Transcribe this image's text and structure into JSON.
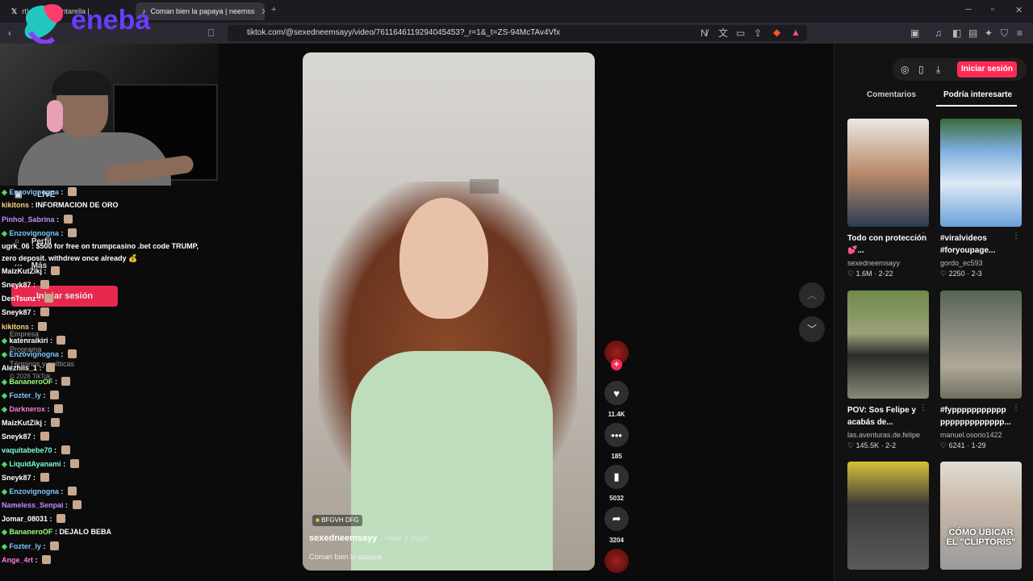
{
  "browser": {
    "tabs": [
      {
        "label": "rt) on X: \"Cantarella | ",
        "icon": "x-logo-icon"
      },
      {
        "label": "Coman bien la papaya | neemss",
        "icon": "tiktok-icon"
      }
    ],
    "url": "tiktok.com/@sexedneemsayy/video/7611646119294045453?_r=1&_t=ZS-94McTAv4Vfx"
  },
  "stream": {
    "brand": "eneba",
    "chat": [
      {
        "user": "Enzovignogna",
        "text": "",
        "color": "#7ec8ff",
        "badge": true,
        "emote": true
      },
      {
        "user": "kikitons",
        "text": "INFORMACION DE ORO",
        "color": "#ffd27a",
        "badge": false,
        "emote": false
      },
      {
        "user": "Pinhol_Sabrina",
        "text": "",
        "color": "#c08cff",
        "badge": false,
        "emote": true
      },
      {
        "user": "Enzovignogna",
        "text": "",
        "color": "#7ec8ff",
        "badge": true,
        "emote": true
      },
      {
        "user": "ugrk_06",
        "text": "$500 for free on trumpcasino .bet code TRUMP,",
        "color": "#ffffff",
        "badge": false,
        "emote": false
      },
      {
        "user": "",
        "text": "zero deposit. withdrew once already 💰",
        "color": "#ffffff",
        "badge": false,
        "emote": false
      },
      {
        "user": "MaizKutZikj",
        "text": "",
        "color": "#ffffff",
        "badge": false,
        "emote": true
      },
      {
        "user": "Sneyk87",
        "text": "",
        "color": "#ffffff",
        "badge": false,
        "emote": true
      },
      {
        "user": "DenTsunz",
        "text": "",
        "color": "#ffffff",
        "badge": false,
        "emote": true
      },
      {
        "user": "Sneyk87",
        "text": "",
        "color": "#ffffff",
        "badge": false,
        "emote": true
      },
      {
        "user": "kikitons",
        "text": "",
        "color": "#ffd27a",
        "badge": false,
        "emote": true
      },
      {
        "user": "katenraikiri",
        "text": "",
        "color": "#ffffff",
        "badge": true,
        "emote": true
      },
      {
        "user": "Enzovignogna",
        "text": "",
        "color": "#7ec8ff",
        "badge": true,
        "emote": true
      },
      {
        "user": "Alezhiis_1",
        "text": "",
        "color": "#ffffff",
        "badge": false,
        "emote": true
      },
      {
        "user": "BananeroOF",
        "text": "",
        "color": "#9cff7a",
        "badge": true,
        "emote": true
      },
      {
        "user": "Fozter_ly",
        "text": "",
        "color": "#7ec8ff",
        "badge": true,
        "emote": true
      },
      {
        "user": "Darknerox",
        "text": "",
        "color": "#ff7ad9",
        "badge": true,
        "emote": true
      },
      {
        "user": "MaizKutZikj",
        "text": "",
        "color": "#ffffff",
        "badge": false,
        "emote": true
      },
      {
        "user": "Sneyk87",
        "text": "",
        "color": "#ffffff",
        "badge": false,
        "emote": true
      },
      {
        "user": "vaquitabebe70",
        "text": "",
        "color": "#7affd8",
        "badge": false,
        "emote": true
      },
      {
        "user": "LiquidAyanami",
        "text": "",
        "color": "#7affd8",
        "badge": true,
        "emote": true
      },
      {
        "user": "Sneyk87",
        "text": "",
        "color": "#ffffff",
        "badge": false,
        "emote": true
      },
      {
        "user": "Enzovignogna",
        "text": "",
        "color": "#7ec8ff",
        "badge": true,
        "emote": true
      },
      {
        "user": "Nameless_Senpai",
        "text": "",
        "color": "#c08cff",
        "badge": false,
        "emote": true
      },
      {
        "user": "Jomar_08031",
        "text": "",
        "color": "#ffffff",
        "badge": false,
        "emote": true
      },
      {
        "user": "BananeroOF",
        "text": "DEJALO BEBA",
        "color": "#9cff7a",
        "badge": true,
        "emote": false
      },
      {
        "user": "Fozter_ly",
        "text": "",
        "color": "#7ec8ff",
        "badge": true,
        "emote": true
      },
      {
        "user": "Ange_4rt",
        "text": "",
        "color": "#ff7ad9",
        "badge": false,
        "emote": true
      }
    ]
  },
  "tiktok_side": {
    "live": "LIVE",
    "perfil": "Perfil",
    "mas": "Más",
    "login": "Iniciar sesión",
    "empresa": "Empresa",
    "programa": "Programa",
    "terminos": "Términos y políticas",
    "copyright": "© 2026 TikTok"
  },
  "video": {
    "badge": "BFGVH DFG",
    "author": "sexedneemsayy",
    "time": "· Hace 3 día(s)",
    "caption": "Coman bien la papaya",
    "likes": "11.4K",
    "comments": "185",
    "saves": "5032",
    "shares": "3204"
  },
  "right_panel": {
    "login": "Iniciar sesión",
    "tab_comments": "Comentarios",
    "tab_recommended": "Podría interesarte",
    "cards": [
      {
        "title": "Todo con protección 💕...",
        "author": "sexedneemsayy",
        "likes": "1.6M",
        "date": "2-22",
        "overlay": ""
      },
      {
        "title": "#viralvideos #foryoupage...",
        "author": "gordo_ec593",
        "likes": "2250",
        "date": "2-3",
        "overlay": ""
      },
      {
        "title": "POV: Sos Felipe y acabás de...",
        "author": "las.aventuras.de.felipe",
        "likes": "145.5K",
        "date": "2-2",
        "overlay": ""
      },
      {
        "title": "#fyppppppppppp ppppppppppppp...",
        "author": "manuel.osorio1422",
        "likes": "6241",
        "date": "1-29",
        "overlay": ""
      },
      {
        "title": "",
        "author": "",
        "likes": "",
        "date": "",
        "overlay": ""
      },
      {
        "title": "",
        "author": "",
        "likes": "",
        "date": "",
        "overlay": "CÓMO UBICAR EL \"CLIPTORIS\""
      }
    ]
  }
}
